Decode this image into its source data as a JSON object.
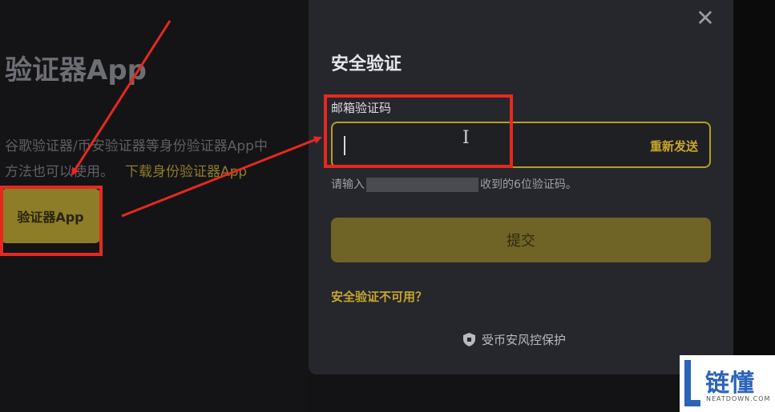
{
  "background": {
    "title": "验证器App",
    "line1": "谷歌验证器/币安验证器等身份验证器App中",
    "line2": "方法也可以使用。",
    "download_link": "下载身份验证器App",
    "button_label": "验证器App"
  },
  "modal": {
    "title": "安全验证",
    "field_label": "邮箱验证码",
    "input_value": "",
    "resend_label": "重新发送",
    "hint_prefix": "请输入",
    "hint_suffix": "收到的6位验证码。",
    "submit_label": "提交",
    "unavailable_link": "安全验证不可用？",
    "footer_text": "受币安风控保护",
    "close_glyph": "✕"
  },
  "watermark": {
    "name": "链懂",
    "domain": "NEATDOWN.COM"
  },
  "colors": {
    "accent": "#c8a52d",
    "annotation_red": "#e5291f",
    "modal_bg": "#26272c",
    "page_bg": "#131316"
  }
}
